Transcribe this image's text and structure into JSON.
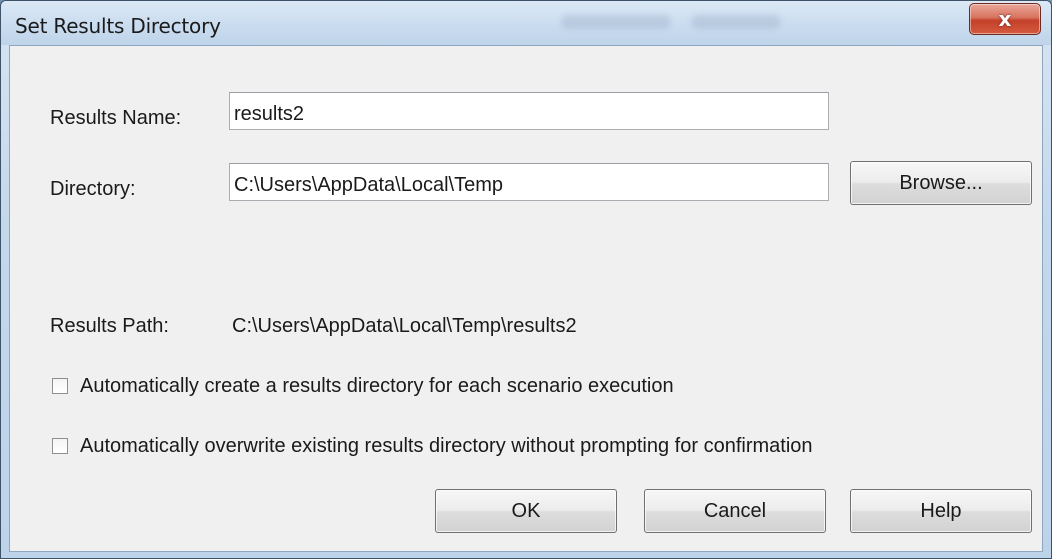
{
  "window": {
    "title": "Set Results Directory",
    "close_glyph": "x"
  },
  "form": {
    "results_name_label": "Results Name:",
    "results_name_value": "results2",
    "directory_label": "Directory:",
    "directory_value": "C:\\Users\\AppData\\Local\\Temp",
    "browse_label": "Browse...",
    "results_path_label": "Results Path:",
    "results_path_value": "C:\\Users\\AppData\\Local\\Temp\\results2"
  },
  "options": [
    {
      "label": "Automatically create a results directory for each scenario execution",
      "checked": false
    },
    {
      "label": "Automatically overwrite existing results directory without prompting for confirmation",
      "checked": false
    }
  ],
  "buttons": {
    "ok": "OK",
    "cancel": "Cancel",
    "help": "Help"
  },
  "colors": {
    "title_bar": "#cadcef",
    "client_background": "#f0f0f0",
    "close_button": "#c4402a"
  }
}
